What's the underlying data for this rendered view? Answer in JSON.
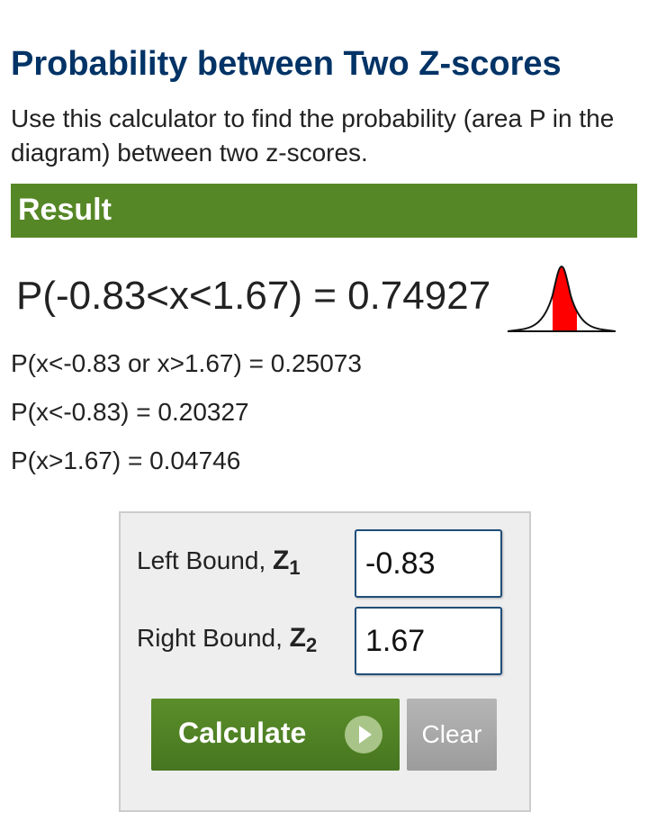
{
  "header": {
    "title": "Probability between Two Z-scores",
    "description": "Use this calculator to find the probability (area P in the diagram) between two z-scores."
  },
  "result": {
    "heading": "Result",
    "main": "P(-0.83<x<1.67) = 0.74927",
    "outside": "P(x<-0.83 or x>1.67) = 0.25073",
    "left_tail": "P(x<-0.83) = 0.20327",
    "right_tail": "P(x>1.67) = 0.04746",
    "diagram_icon": "bell-curve-shaded-icon",
    "shade_color": "#ff0000"
  },
  "form": {
    "left_label": "Left Bound,",
    "left_var": "Z",
    "left_sub": "1",
    "left_value": "-0.83",
    "right_label": "Right Bound,",
    "right_var": "Z",
    "right_sub": "2",
    "right_value": "1.67",
    "calculate_label": "Calculate",
    "calculate_icon": "play-circle-icon",
    "clear_label": "Clear"
  },
  "colors": {
    "title": "#003366",
    "result_bar": "#568726",
    "calculate_button": "#568726",
    "clear_button": "#a9a9a9"
  }
}
